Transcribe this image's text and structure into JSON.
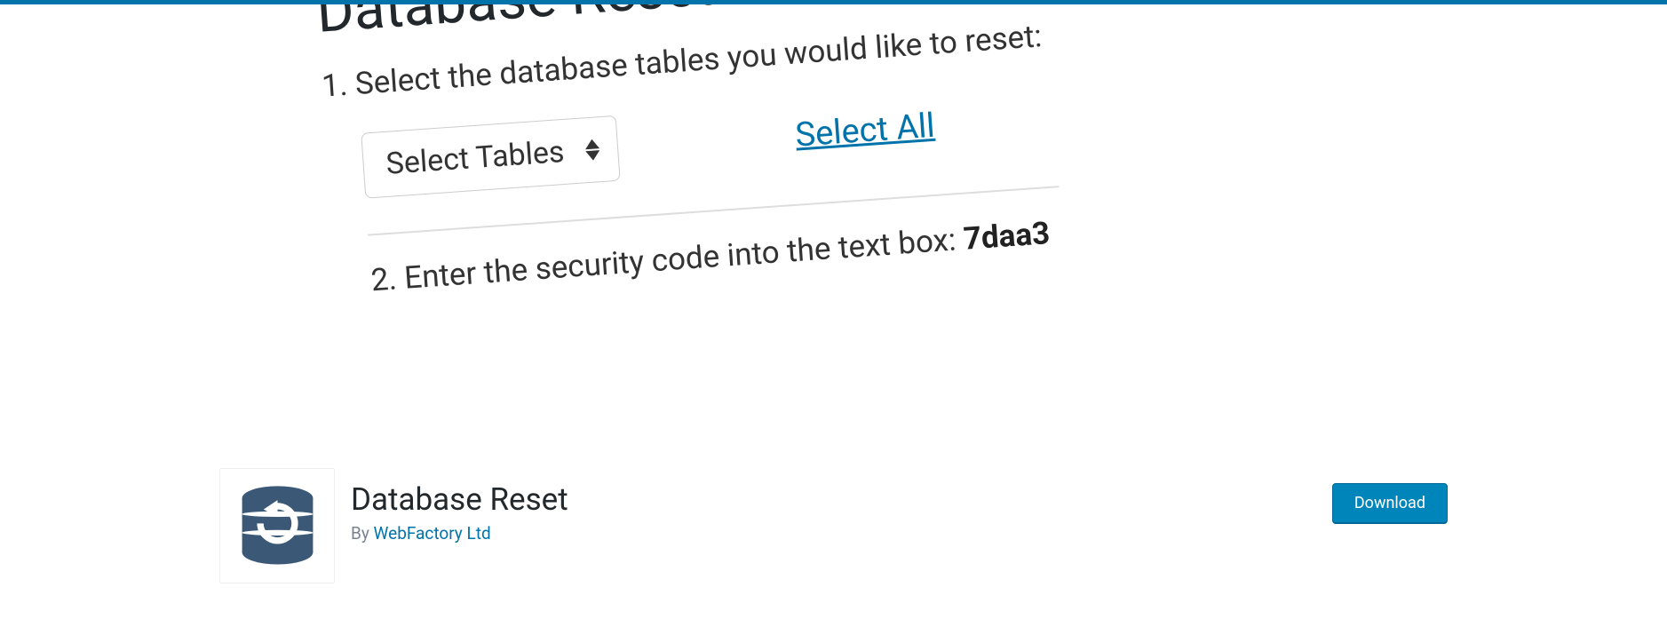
{
  "banner": {
    "title": "Database Reset",
    "step1_text": "1. Select the database tables you would like to reset:",
    "select_label": "Select Tables",
    "select_all_label": "Select All",
    "step2_prefix": "2. Enter the security code into the text box:  ",
    "step2_code": "7daa3"
  },
  "plugin": {
    "title": "Database Reset",
    "by_prefix": "By ",
    "author": "WebFactory Ltd",
    "download_label": "Download"
  },
  "colors": {
    "accent": "#0073aa",
    "button_bg": "#0085ba",
    "icon_bg": "#3b5876"
  }
}
